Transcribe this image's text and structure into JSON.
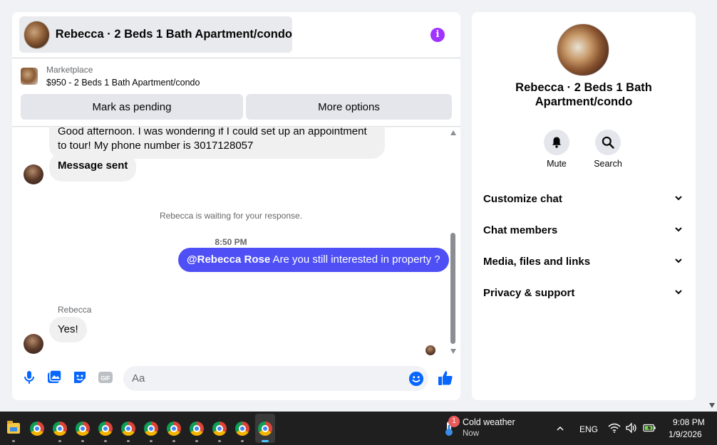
{
  "chat": {
    "title": "Rebecca · 2 Beds 1 Bath Apartment/condo",
    "listing": {
      "label": "Marketplace",
      "price_title": "$950 - 2 Beds 1 Bath Apartment/condo"
    },
    "actions": {
      "mark_pending": "Mark as pending",
      "more_options": "More options"
    },
    "messages": {
      "partial_incoming": "Good afternoon. I was wondering if I could set up an appointment to tour! My phone number is 3017128057",
      "sent_notice": "Message sent",
      "waiting_status": "Rebecca is waiting for your response.",
      "timestamp": "8:50 PM",
      "outgoing_mention": "@Rebecca Rose",
      "outgoing_text": " Are you still interested in property ?",
      "sender_name": "Rebecca",
      "reply": "Yes!"
    },
    "composer": {
      "placeholder": "Aa"
    },
    "colors": {
      "accent": "#4e4ff5",
      "info": "#a033ff",
      "icon_blue": "#0866ff"
    }
  },
  "side": {
    "title": "Rebecca · 2 Beds 1 Bath Apartment/condo",
    "mute_label": "Mute",
    "search_label": "Search",
    "sections": [
      {
        "label": "Customize chat"
      },
      {
        "label": "Chat members"
      },
      {
        "label": "Media, files and links"
      },
      {
        "label": "Privacy & support"
      }
    ]
  },
  "taskbar": {
    "weather_title": "Cold weather",
    "weather_sub": "Now",
    "weather_badge": "1",
    "language": "ENG",
    "time": "9:08 PM",
    "date": "1/9/2026"
  }
}
